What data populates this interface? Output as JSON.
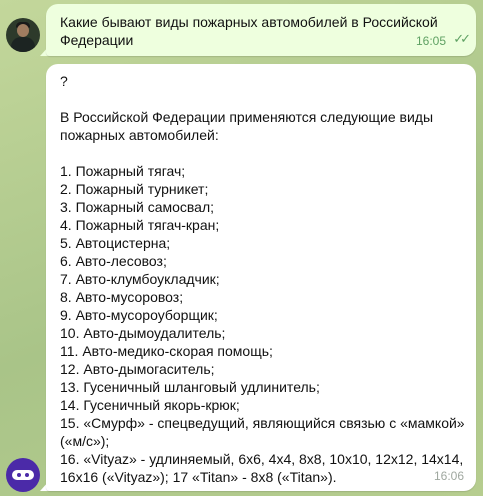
{
  "messages": {
    "question": {
      "text": "Какие бывают виды пожарных автомобилей в Российской Федерации",
      "time": "16:05",
      "read_icon": "double-check-icon"
    },
    "answer": {
      "first_line": "?",
      "intro": "В Российской Федерации применяются следующие виды пожарных автомобилей:",
      "items": [
        "1. Пожарный тягач;",
        "2. Пожарный турникет;",
        "3. Пожарный самосвал;",
        "4. Пожарный тягач-кран;",
        "5. Автоцистерна;",
        "6. Авто-лесовоз;",
        "7. Авто-клумбоукладчик;",
        "8. Авто-мусоровоз;",
        "9. Авто-мусороуборщик;",
        "10. Авто-дымоудалитель;",
        "11. Авто-медико-скорая помощь;",
        "12. Авто-дымогаситель;",
        "13. Гусеничный шланговый удлинитель;",
        "14. Гусеничный якорь-крюк;",
        "15. «Смурф» - спецведущий, являющийся связью с «мамкой» («м/с»);",
        "16. «Vityaz» - удлиняемый, 6х6, 4х4, 8х8, 10х10, 12х12, 14х14, 16х16 («Vityaz»); 17 «Titan» - 8х8 («Titan»)."
      ],
      "time": "16:06"
    }
  },
  "colors": {
    "outgoing_bubble": "#eeffde",
    "incoming_bubble": "#ffffff",
    "chat_background": "#b9cf94",
    "read_ticks": "#5fa163"
  }
}
